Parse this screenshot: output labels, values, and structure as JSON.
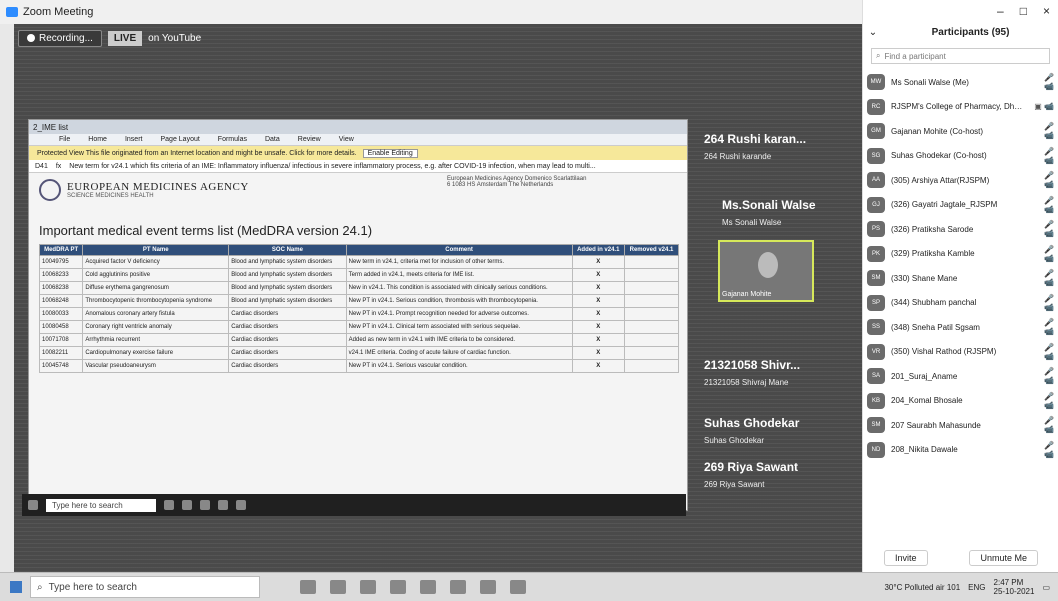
{
  "window": {
    "title": "Zoom Meeting",
    "min": "–",
    "max": "□",
    "close": "×"
  },
  "recording": {
    "label": "Recording...",
    "live": "LIVE",
    "stream": "on YouTube"
  },
  "shared": {
    "window_title": "2_IME list",
    "ribbon": [
      "File",
      "Home",
      "Insert",
      "Page Layout",
      "Formulas",
      "Data",
      "Review",
      "View"
    ],
    "protected_msg": "Protected View  This file originated from an Internet location and might be unsafe. Click for more details.",
    "enable_btn": "Enable Editing",
    "cell_ref": "D41",
    "formula": "New term for v24.1 which fits criteria of an IME: Inflammatory influenza/ infectious in severe inflammatory process, e.g. after COVID-19 infection, when may lead to multi...",
    "agency": "EUROPEAN MEDICINES AGENCY",
    "agency_sub": "SCIENCE MEDICINES HEALTH",
    "agency_right": "European Medicines Agency  Domenico Scarlattilaan 6  1083 HS Amsterdam  The Netherlands",
    "doc_title": "Important medical event terms list (MedDRA version 24.1)",
    "headers": [
      "MedDRA PT",
      "PT Name",
      "SOC Name",
      "Comment",
      "Added in v24.1",
      "Removed v24.1"
    ],
    "rows": [
      [
        "10049795",
        "Acquired factor V deficiency",
        "Blood and lymphatic system disorders",
        "New term in v24.1, criteria met for inclusion of other terms.",
        "X",
        ""
      ],
      [
        "10068233",
        "Cold agglutinins positive",
        "Blood and lymphatic system disorders",
        "Term added in v24.1, meets criteria for IME list.",
        "X",
        ""
      ],
      [
        "10068238",
        "Diffuse erythema gangrenosum",
        "Blood and lymphatic system disorders",
        "New in v24.1. This condition is associated with clinically serious conditions.",
        "X",
        ""
      ],
      [
        "10068248",
        "Thrombocytopenic thrombocytopenia syndrome",
        "Blood and lymphatic system disorders",
        "New PT in v24.1. Serious condition, thrombosis with thrombocytopenia.",
        "X",
        ""
      ],
      [
        "10080033",
        "Anomalous coronary artery fistula",
        "Cardiac disorders",
        "New PT in v24.1. Prompt recognition needed for adverse outcomes.",
        "X",
        ""
      ],
      [
        "10080458",
        "Coronary right ventricle anomaly",
        "Cardiac disorders",
        "New PT in v24.1. Clinical term associated with serious sequelae.",
        "X",
        ""
      ],
      [
        "10071708",
        "Arrhythmia recurrent",
        "Cardiac disorders",
        "Added as new term in v24.1 with IME criteria to be considered.",
        "X",
        ""
      ],
      [
        "10082211",
        "Cardiopulmonary exercise failure",
        "Cardiac disorders",
        "v24.1 IME criteria. Coding of acute failure of cardiac function.",
        "X",
        ""
      ],
      [
        "10045748",
        "Vascular pseudoaneurysm",
        "Cardiac disorders",
        "New PT in v24.1. Serious vascular condition.",
        "X",
        ""
      ]
    ],
    "taskbar_search": "Type here to search"
  },
  "tiles": [
    {
      "name": "264 Rushi karan...",
      "sub": "264 Rushi karande"
    },
    {
      "name": "Ms.Sonali Walse",
      "sub": "Ms Sonali Walse"
    },
    {
      "name": "21321058 Shivr...",
      "sub": "21321058 Shivraj Mane"
    },
    {
      "name": "Suhas Ghodekar",
      "sub": "Suhas Ghodekar"
    },
    {
      "name": "269 Riya Sawant",
      "sub": "269 Riya Sawant"
    }
  ],
  "video_caption": "Gajanan Mohite",
  "participants": {
    "title": "Participants (95)",
    "find_placeholder": "Find a participant",
    "list": [
      {
        "initials": "MW",
        "name": "Ms Sonali Walse (Me)",
        "icons": "🎤 📹"
      },
      {
        "initials": "RC",
        "name": "RJSPM's College of Pharmacy, Dhon...",
        "icons": "▣ 📹"
      },
      {
        "initials": "GM",
        "name": "Gajanan Mohite (Co-host)",
        "icons": "🎤 📹"
      },
      {
        "initials": "SG",
        "name": "Suhas Ghodekar (Co-host)",
        "icons": "🎤 📹"
      },
      {
        "initials": "AA",
        "name": "(305) Arshiya Attar(RJSPM)",
        "icons": "🎤 📹"
      },
      {
        "initials": "GJ",
        "name": "(326) Gayatri Jagtale_RJSPM",
        "icons": "🎤 📹"
      },
      {
        "initials": "PS",
        "name": "(326) Pratiksha Sarode",
        "icons": "🎤 📹"
      },
      {
        "initials": "PK",
        "name": "(329) Pratiksha Kamble",
        "icons": "🎤 📹"
      },
      {
        "initials": "SM",
        "name": "(330) Shane Mane",
        "icons": "🎤 📹"
      },
      {
        "initials": "SP",
        "name": "(344) Shubham panchal",
        "icons": "🎤 📹"
      },
      {
        "initials": "SS",
        "name": "(348) Sneha Patil Sgsam",
        "icons": "🎤 📹"
      },
      {
        "initials": "VR",
        "name": "(350) Vishal Rathod (RJSPM)",
        "icons": "🎤 📹"
      },
      {
        "initials": "SA",
        "name": "201_Suraj_Aname",
        "icons": "🎤 📹"
      },
      {
        "initials": "KB",
        "name": "204_Komal Bhosale",
        "icons": "🎤 📹"
      },
      {
        "initials": "SM",
        "name": "207 Saurabh Mahasunde",
        "icons": "🎤 📹"
      },
      {
        "initials": "ND",
        "name": "208_Nikita Dawale",
        "icons": "🎤 📹"
      }
    ],
    "invite": "Invite",
    "unmute": "Unmute Me"
  },
  "taskbar": {
    "search": "Type here to search",
    "weather": "30°C Polluted air 101",
    "lang": "ENG",
    "time": "2:47 PM",
    "date": "25-10-2021"
  }
}
